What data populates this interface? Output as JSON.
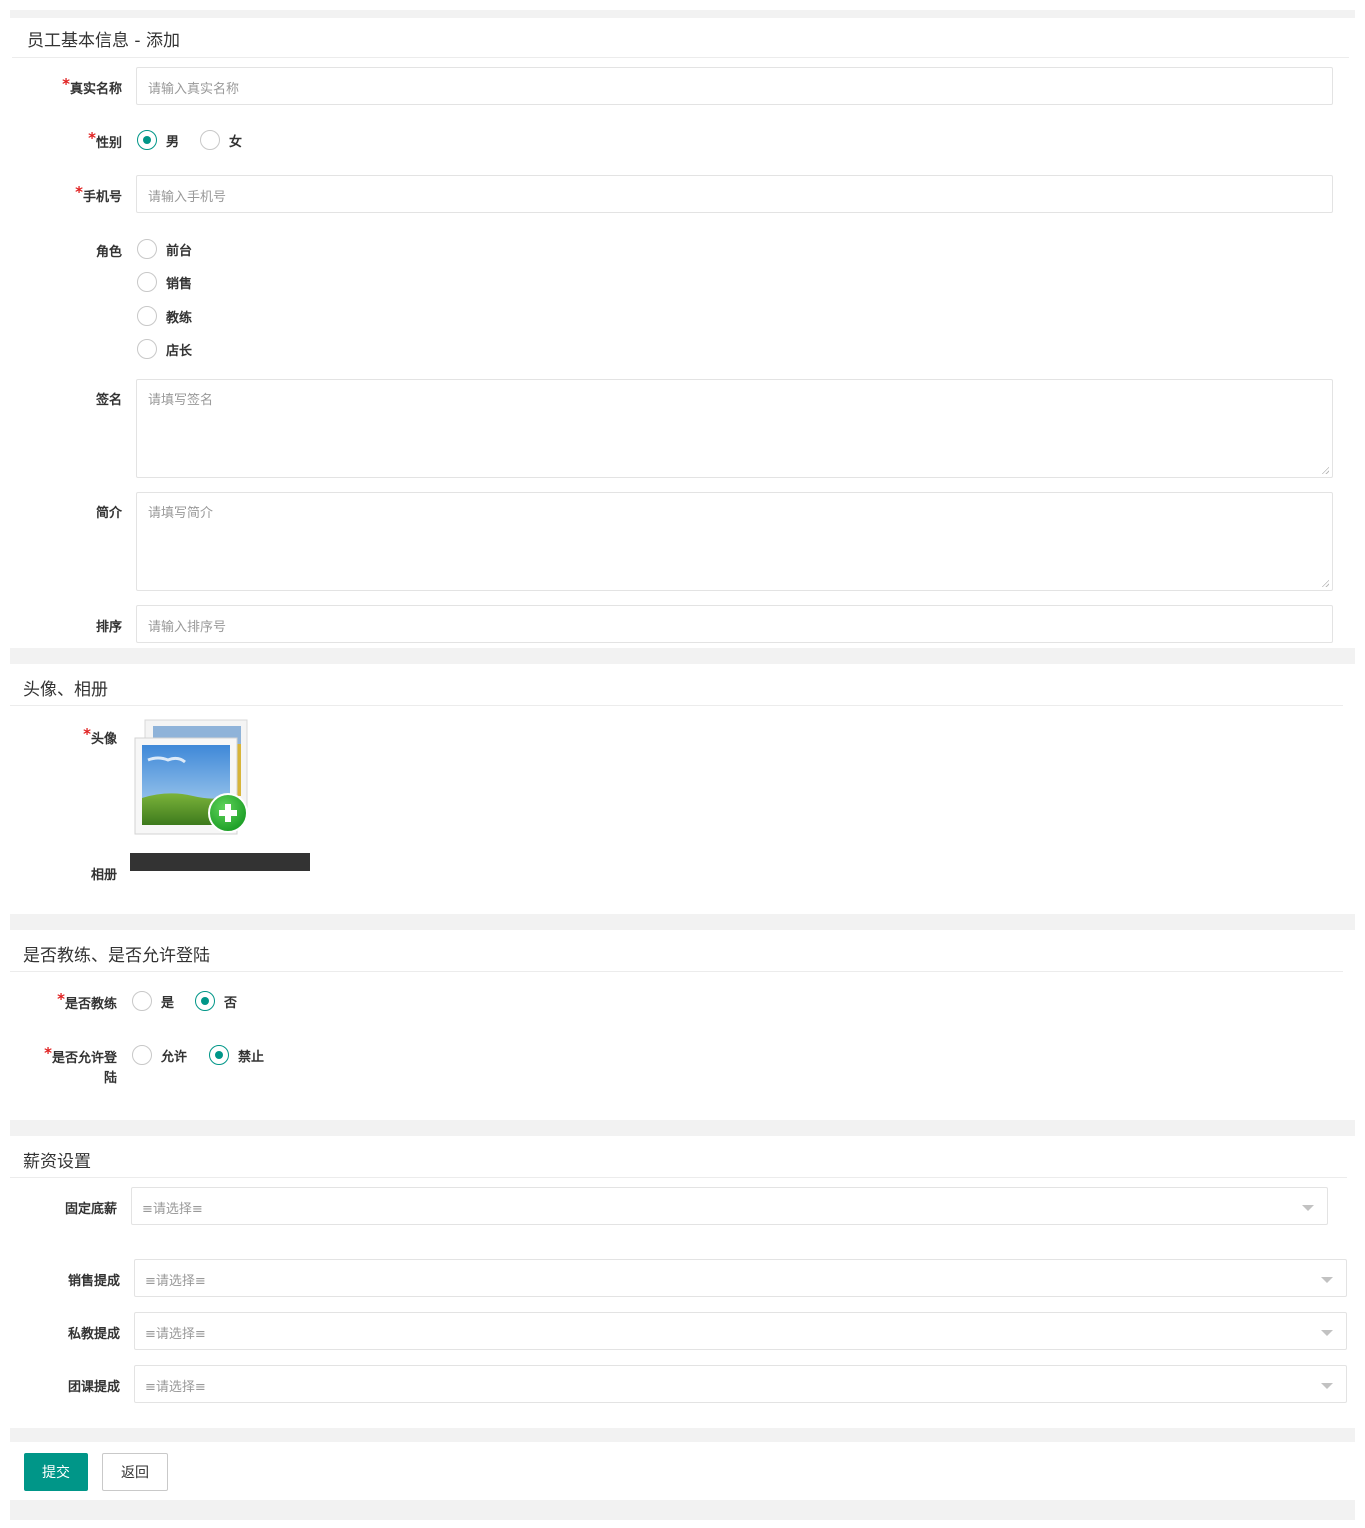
{
  "sections": {
    "basic": {
      "title": "员工基本信息 - 添加",
      "real_name": {
        "label": "真实名称",
        "placeholder": "请输入真实名称"
      },
      "gender": {
        "label": "性别",
        "options": [
          "男",
          "女"
        ],
        "selected": "男"
      },
      "phone": {
        "label": "手机号",
        "placeholder": "请输入手机号"
      },
      "role": {
        "label": "角色",
        "options": [
          "前台",
          "销售",
          "教练",
          "店长"
        ]
      },
      "signature": {
        "label": "签名",
        "placeholder": "请填写签名"
      },
      "intro": {
        "label": "简介",
        "placeholder": "请填写简介"
      },
      "sort": {
        "label": "排序",
        "placeholder": "请输入排序号"
      }
    },
    "media": {
      "title": "头像、相册",
      "avatar_label": "头像",
      "album_label": "相册"
    },
    "flags": {
      "title": "是否教练、是否允许登陆",
      "is_coach": {
        "label": "是否教练",
        "options": [
          "是",
          "否"
        ],
        "selected": "否"
      },
      "allow_login": {
        "label_line1": "是否允许登",
        "label_line2": "陆",
        "options": [
          "允许",
          "禁止"
        ],
        "selected": "禁止"
      }
    },
    "salary": {
      "title": "薪资设置",
      "base": {
        "label": "固定底薪",
        "placeholder": "≡请选择≡"
      },
      "sales": {
        "label": "销售提成",
        "placeholder": "≡请选择≡"
      },
      "private": {
        "label": "私教提成",
        "placeholder": "≡请选择≡"
      },
      "group": {
        "label": "团课提成",
        "placeholder": "≡请选择≡"
      }
    }
  },
  "actions": {
    "submit": "提交",
    "back": "返回"
  },
  "colors": {
    "accent": "#009688",
    "required": "#e02020",
    "panel_bg": "#f2f2f2"
  }
}
